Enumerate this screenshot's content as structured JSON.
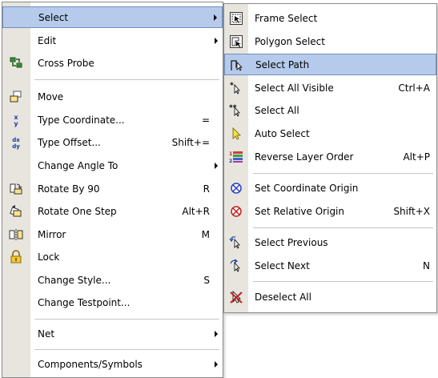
{
  "main_menu": {
    "items": [
      {
        "label": "Select",
        "has_submenu": true,
        "icon": "none"
      },
      {
        "label": "Edit",
        "has_submenu": true,
        "icon": "none"
      },
      {
        "label": "Cross Probe",
        "icon": "cross-probe-icon"
      },
      {
        "label": "Move",
        "icon": "move-icon"
      },
      {
        "label": "Type Coordinate...",
        "shortcut": "=",
        "icon": "type-coordinate-icon"
      },
      {
        "label": "Type Offset...",
        "shortcut": "Shift+=",
        "icon": "type-offset-icon"
      },
      {
        "label": "Change Angle To",
        "has_submenu": true,
        "icon": "none"
      },
      {
        "label": "Rotate By 90",
        "shortcut": "R",
        "icon": "rotate-by-90-icon"
      },
      {
        "label": "Rotate One Step",
        "shortcut": "Alt+R",
        "icon": "rotate-one-step-icon"
      },
      {
        "label": "Mirror",
        "shortcut": "M",
        "icon": "mirror-icon"
      },
      {
        "label": "Lock",
        "icon": "lock-icon"
      },
      {
        "label": "Change Style...",
        "shortcut": "S",
        "icon": "none"
      },
      {
        "label": "Change Testpoint...",
        "icon": "none"
      },
      {
        "label": "Net",
        "has_submenu": true,
        "icon": "none"
      },
      {
        "label": "Components/Symbols",
        "has_submenu": true,
        "icon": "none"
      }
    ]
  },
  "select_submenu": {
    "items": [
      {
        "label": "Frame Select",
        "icon": "frame-select-icon"
      },
      {
        "label": "Polygon Select",
        "icon": "polygon-select-icon"
      },
      {
        "label": "Select Path",
        "icon": "select-path-icon",
        "highlighted": true
      },
      {
        "label": "Select All Visible",
        "shortcut": "Ctrl+A",
        "icon": "select-all-visible-icon"
      },
      {
        "label": "Select All",
        "icon": "select-all-icon"
      },
      {
        "label": "Auto Select",
        "icon": "auto-select-icon"
      },
      {
        "label": "Reverse Layer Order",
        "shortcut": "Alt+P",
        "icon": "reverse-layer-order-icon"
      },
      {
        "label": "Set Coordinate Origin",
        "icon": "set-coordinate-origin-icon"
      },
      {
        "label": "Set Relative Origin",
        "shortcut": "Shift+X",
        "icon": "set-relative-origin-icon"
      },
      {
        "label": "Select Previous",
        "icon": "select-previous-icon"
      },
      {
        "label": "Select Next",
        "shortcut": "N",
        "icon": "select-next-icon"
      },
      {
        "label": "Deselect All",
        "icon": "deselect-all-icon"
      }
    ]
  },
  "colors": {
    "highlight_fill": "#b6cbec",
    "highlight_border": "#6e8ebd",
    "gutter": "#e7e5de",
    "menu_border": "#8a8a8a"
  }
}
